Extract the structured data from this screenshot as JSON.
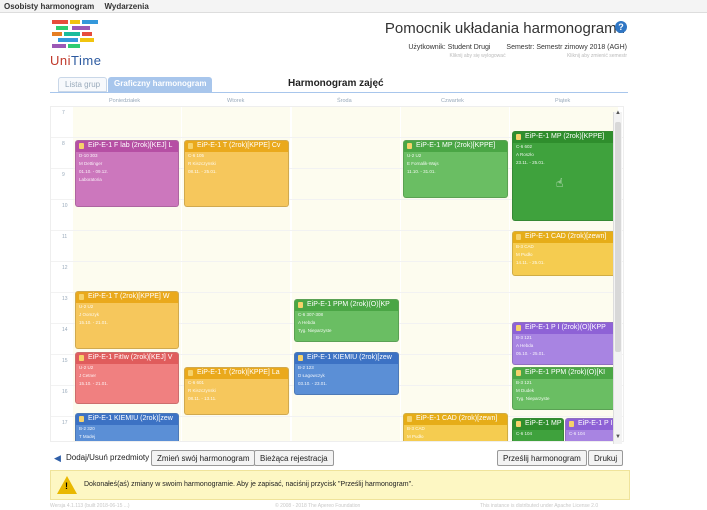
{
  "menu": {
    "items": [
      "Osobisty harmonogram",
      "Wydarzenia"
    ]
  },
  "logo": {
    "text_uni": "Uni",
    "text_time": "Time"
  },
  "header": {
    "title": "Pomocnik układania harmonogramu",
    "user_label": "Użytkownik: Student Drugi",
    "semester_label": "Semestr: Semestr zimowy 2018 (AGH)",
    "user_hint": "Kliknij aby się wylogować",
    "semester_hint": "Kliknij aby zmienić semestr"
  },
  "tabs": {
    "list": "Lista grup",
    "grid": "Graficzny harmonogram"
  },
  "schedule_title": "Harmonogram zajęć",
  "days": [
    "Poniedziałek",
    "Wtorek",
    "Środa",
    "Czwartek",
    "Piątek"
  ],
  "hours": [
    "7",
    "8",
    "9",
    "10",
    "11",
    "12",
    "13",
    "14",
    "15",
    "16",
    "17"
  ],
  "events": [
    {
      "title": "EiP-E-1 F lab (2rok)[KEJ] L",
      "lines": [
        "D-10 303",
        "M Dettinger",
        "01.10. - 09.12.",
        "Laboratoria"
      ],
      "color": "c-pink"
    },
    {
      "title": "EiP-E-1 T (2rok)[KPPE] Cv",
      "lines": [
        "C-6 105",
        "R Kiszczynski",
        "08.11. - 25.01."
      ],
      "color": "c-yellow"
    },
    {
      "title": "EiP-E-1 MP (2rok)[KPPE]",
      "lines": [
        "U-2 U2",
        "E Fornalik-Wajs",
        "11.10. - 31.01."
      ],
      "color": "c-green"
    },
    {
      "title": "EiP-E-1 MP (2rok)[KPPE]",
      "lines": [
        "C-6 602",
        "A Roszło",
        "23.11. - 25.01."
      ],
      "color": "c-green2"
    },
    {
      "title": "EiP-E-1 CAD (2rok)[zewn]",
      "lines": [
        "B-3 CAD",
        "M Pudło",
        "14.11. - 25.01."
      ],
      "color": "c-yellow2"
    },
    {
      "title": "EiP-E-1 T (2rok)[KPPE] W",
      "lines": [
        "U-2 U2",
        "J Oomzyk",
        "15.10. - 21.01."
      ],
      "color": "c-yellow"
    },
    {
      "title": "EiP-E-1 PPM (2rok)(O)[KP",
      "lines": [
        "C-6 307-308",
        "A Hebda",
        "Tyg. Nieparzyste"
      ],
      "color": "c-green"
    },
    {
      "title": "EiP-E-1 P I (2rok)(O)[KPP",
      "lines": [
        "B-3 121",
        "A Hebda",
        "05.10. - 25.01."
      ],
      "color": "c-purple"
    },
    {
      "title": "EiP-E-1 FitIw (2rok)[KEJ] V",
      "lines": [
        "U-2 U2",
        "J Cetner",
        "15.10. - 21.01."
      ],
      "color": "c-red"
    },
    {
      "title": "EiP-E-1 T (2rok)[KPPE] La",
      "lines": [
        "C-6 601",
        "R Kiszczynski",
        "08.11. - 13.11."
      ],
      "color": "c-yellow"
    },
    {
      "title": "EiP-E-1 KIEMIU (2rok)[zew",
      "lines": [
        "B-2 123",
        "D Łagowczyk",
        "03.10. - 23.01."
      ],
      "color": "c-blue"
    },
    {
      "title": "EiP-E-1 PPM (2rok)(O)[KI",
      "lines": [
        "B-3 121",
        "M Dudek",
        "Tyg. Nieparzyste"
      ],
      "color": "c-green"
    },
    {
      "title": "EiP-E-1 KIEMIU (2rok)[zew",
      "lines": [
        "B-2 320",
        "T Madej"
      ],
      "color": "c-blue"
    },
    {
      "title": "EiP-E-1 CAD (2rok)[zewn]",
      "lines": [
        "B-3 CAD",
        "M Pudło"
      ],
      "color": "c-yellow2"
    },
    {
      "title": "EiP-E-1 MP",
      "lines": [
        "C-6 104"
      ],
      "color": "c-green2"
    },
    {
      "title": "EiP-E-1 P I",
      "lines": [
        "C-6 104"
      ],
      "color": "c-purple"
    }
  ],
  "toolbar": {
    "add_remove": "Dodaj/Usuń przedmioty",
    "change": "Zmień swój harmonogram",
    "current_reg": "Bieżąca rejestracja",
    "submit": "Prześlij harmonogram",
    "print": "Drukuj"
  },
  "warning": {
    "text": "Dokonałeś(aś) zmiany w swoim harmonogramie. Aby je zapisać, naciśnij przycisk \"Prześlij harmonogram\"."
  },
  "footer": {
    "version": "Wersja 4.1.113 (built 2018-06-15 ...)",
    "copyright": "© 2008 - 2018 The Apereo Foundation",
    "distributed": "This instance is distributed under Apache License 2.0"
  }
}
